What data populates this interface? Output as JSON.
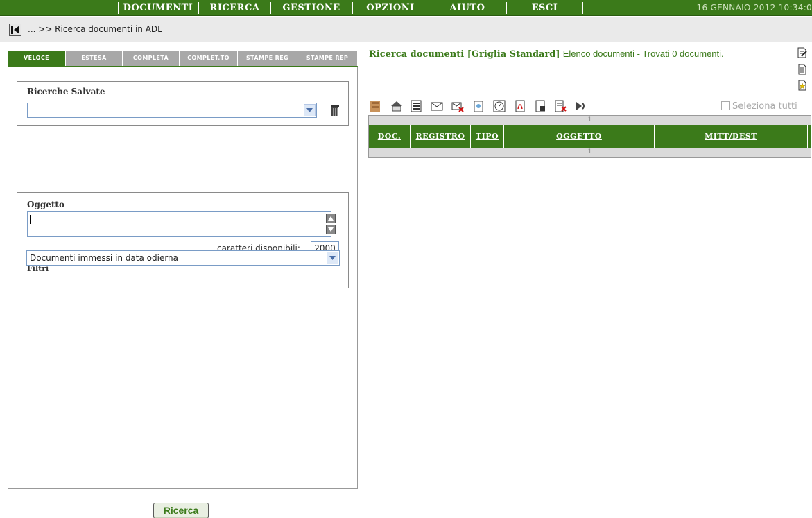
{
  "menu": {
    "items": [
      "DOCUMENTI",
      "RICERCA",
      "GESTIONE",
      "OPZIONI",
      "AIUTO",
      "ESCI"
    ],
    "datetime": "16 GENNAIO 2012 10:34:0"
  },
  "breadcrumb": "... >> Ricerca documenti in ADL",
  "tabs": [
    "VELOCE",
    "ESTESA",
    "COMPLETA",
    "COMPLET.TO",
    "STAMPE REG",
    "STAMPE REP"
  ],
  "saved_searches": {
    "label": "Ricerche Salvate",
    "selected": ""
  },
  "oggetto": {
    "label": "Oggetto",
    "value": "",
    "chars_label": "caratteri disponibili:",
    "chars_available": "2000"
  },
  "filtri": {
    "label": "Filtri",
    "selected": "Documenti immessi in data odierna"
  },
  "submit_label": "Ricerca",
  "results": {
    "title": "Ricerca documenti [Griglia Standard]",
    "summary": "Elenco documenti - Trovati 0 documenti.",
    "select_all_label": "Seleziona tutti",
    "pager_top": "1",
    "pager_bottom": "1",
    "columns": [
      "DOC.",
      "REGISTRO",
      "TIPO",
      "OGGETTO",
      "MITT/DEST"
    ]
  },
  "colors": {
    "brand_green": "#3b7a1a",
    "tab_inactive": "#a8a8a8"
  },
  "icons": {
    "toolbar": [
      "stamp-icon",
      "home-icon",
      "list-icon",
      "envelope-icon",
      "mail-delete-icon",
      "document-icon",
      "clock-icon",
      "pdf-icon",
      "export-icon",
      "delete-icon",
      "forward-icon"
    ],
    "side": [
      "edit-doc-icon",
      "doc-icon",
      "star-doc-icon"
    ]
  }
}
